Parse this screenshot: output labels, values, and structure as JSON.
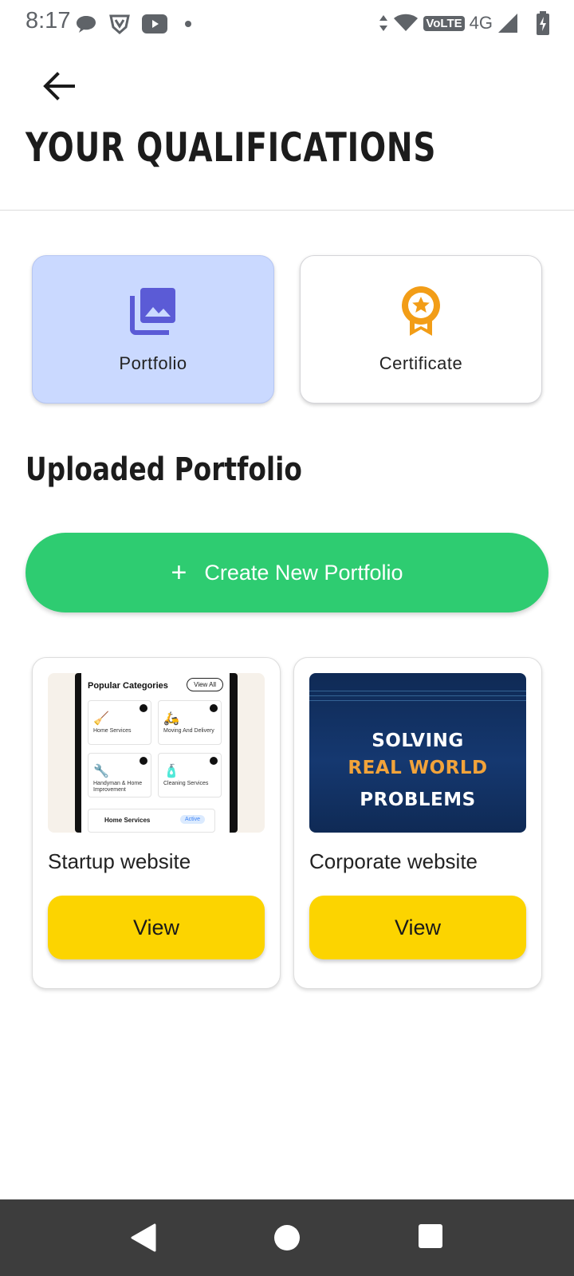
{
  "status_bar": {
    "time": "8:17",
    "icons": [
      "chat-bubble-icon",
      "shield-icon",
      "youtube-icon",
      "dot-icon",
      "data-arrows-icon",
      "wifi-icon",
      "volte-badge",
      "signal-icon",
      "battery-charging-icon"
    ],
    "volte": "VoLTE",
    "network": "4G"
  },
  "header": {
    "title": "YOUR QUALIFICATIONS"
  },
  "qualification_types": [
    {
      "label": "Portfolio",
      "icon": "photo-library-icon",
      "selected": true,
      "color": "#5b5bd6"
    },
    {
      "label": "Certificate",
      "icon": "award-ribbon-icon",
      "selected": false,
      "color": "#f29d17"
    }
  ],
  "section": {
    "title": "Uploaded Portfolio"
  },
  "create_button": {
    "icon": "plus-icon",
    "label": "Create New Portfolio",
    "color": "#2ecc71"
  },
  "portfolios": [
    {
      "name": "Startup website",
      "view_label": "View",
      "thumbnail": {
        "heading": "Popular Categories",
        "view_all": "View All",
        "tiles": [
          "Home Services",
          "Moving And Delivery",
          "Handyman & Home Improvement",
          "Cleaning Services"
        ],
        "row_label": "Home Services",
        "row_badge": "Active"
      }
    },
    {
      "name": "Corporate website",
      "view_label": "View",
      "thumbnail": {
        "lines": [
          "SOLVING",
          "REAL WORLD",
          "PROBLEMS"
        ],
        "accent": "#f2a33a"
      }
    }
  ],
  "colors": {
    "view_button": "#fcd400",
    "selected_card": "#cad9ff"
  },
  "nav": {
    "buttons": [
      "back-triangle-icon",
      "home-circle-icon",
      "recents-square-icon"
    ]
  }
}
